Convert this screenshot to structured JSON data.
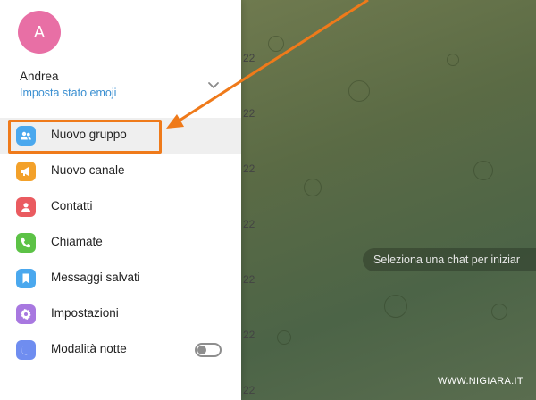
{
  "profile": {
    "avatar_initial": "A",
    "name": "Andrea",
    "status_link": "Imposta stato emoji"
  },
  "menu": [
    {
      "label": "Nuovo gruppo",
      "icon": "group-icon",
      "color": "#4aa8ee"
    },
    {
      "label": "Nuovo canale",
      "icon": "megaphone-icon",
      "color": "#f3a12a"
    },
    {
      "label": "Contatti",
      "icon": "person-icon",
      "color": "#ea5b60"
    },
    {
      "label": "Chiamate",
      "icon": "phone-icon",
      "color": "#5cc246"
    },
    {
      "label": "Messaggi salvati",
      "icon": "bookmark-icon",
      "color": "#4aa8ee"
    },
    {
      "label": "Impostazioni",
      "icon": "gear-icon",
      "color": "#a878e0"
    },
    {
      "label": "Modalità notte",
      "icon": "moon-icon",
      "color": "#6f8df0"
    }
  ],
  "night_mode_enabled": false,
  "background": {
    "empty_chat_text": "Seleziona una chat per iniziar",
    "time_fragments": [
      "22",
      "22",
      "22",
      "22",
      "22",
      "22",
      "22",
      "22",
      "22"
    ]
  },
  "annotation": {
    "highlight_color": "#ef7a1a"
  },
  "watermark": "WWW.NIGIARA.IT"
}
